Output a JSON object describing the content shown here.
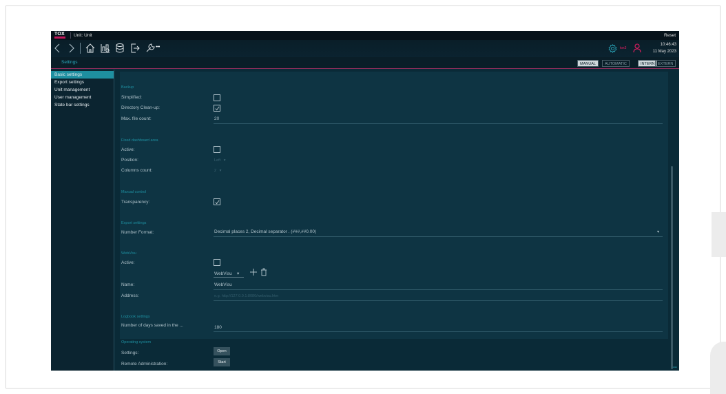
{
  "titlebar": {
    "logo_text": "TOX",
    "unit": "Unit: Unit",
    "reset_label": "Reset"
  },
  "toolbar": {
    "icons": [
      "back-icon",
      "forward-icon",
      "home-icon",
      "process-icon",
      "database-icon",
      "logout-icon",
      "wrench-icon",
      "more-icon"
    ],
    "more_label": "•••",
    "user_name": "tox3",
    "time": "10:46:43",
    "date": "11 May 2023"
  },
  "subheader": {
    "title": "Settings",
    "mode": {
      "manual": "MANUAL",
      "automatic": "AUTOMATIC",
      "selected": "MANUAL"
    },
    "source": {
      "intern": "INTERN",
      "extern": "EXTERN",
      "selected": "INTERN"
    }
  },
  "sidebar": {
    "items": [
      {
        "label": "Basic settings",
        "active": true
      },
      {
        "label": "Export settings",
        "active": false
      },
      {
        "label": "Unit management",
        "active": false
      },
      {
        "label": "User management",
        "active": false
      },
      {
        "label": "State bar settings",
        "active": false
      }
    ]
  },
  "backup": {
    "title": "Backup",
    "simplified_label": "Simplified:",
    "simplified_checked": false,
    "cleanup_label": "Directory Clean-up:",
    "cleanup_checked": true,
    "max_files_label": "Max. file count:",
    "max_files_value": "20"
  },
  "fixed_dashboard": {
    "title": "Fixed dashboard area",
    "active_label": "Active:",
    "active_checked": false,
    "position_label": "Position:",
    "position_value": "Left",
    "columns_label": "Columns count:",
    "columns_value": "2"
  },
  "manual_control": {
    "title": "Manual control",
    "transparency_label": "Transparency:",
    "transparency_checked": true
  },
  "export_settings": {
    "title": "Export settings",
    "number_format_label": "Number Format:",
    "number_format_value": "Decimal places 2, Decimal separator . (###,##0.00)"
  },
  "webvisu": {
    "title": "WebVisu",
    "active_label": "Active:",
    "active_checked": false,
    "selector_value": "WebVisu",
    "name_label": "Name:",
    "name_value": "WebVisu",
    "address_label": "Address:",
    "address_placeholder": "e.g. http://127.0.0.1:8080/webvisu.htm"
  },
  "logbook": {
    "title": "Logbook settings",
    "days_label": "Number of days saved in the ...",
    "days_value": "180"
  },
  "operating_system": {
    "title": "Operating system",
    "settings_label": "Settings:",
    "settings_button": "Open",
    "remote_label": "Remote Administration:",
    "remote_button": "Start"
  },
  "status_mini": "1024",
  "colors": {
    "accent": "#1e8fa0",
    "brand": "#c2185b",
    "background": "#0a2a37",
    "panel": "#0e3443",
    "user": "#e91e63"
  }
}
